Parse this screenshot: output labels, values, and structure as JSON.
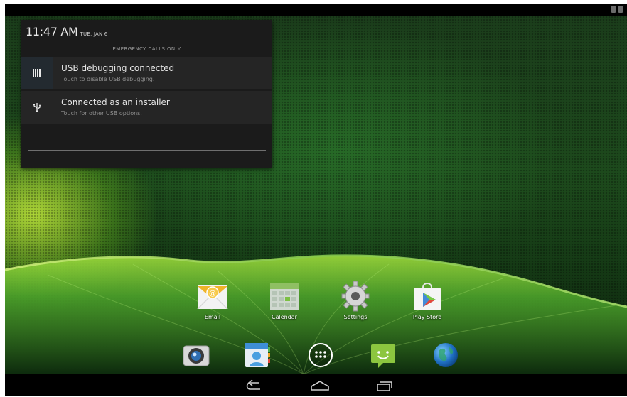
{
  "notification_panel": {
    "time": "11:47 AM",
    "date": "TUE, JAN 6",
    "carrier_status": "EMERGENCY CALLS ONLY",
    "notifications": [
      {
        "icon": "usb-debug-icon",
        "title": "USB debugging connected",
        "subtitle": "Touch to disable USB debugging."
      },
      {
        "icon": "usb-icon",
        "title": "Connected as an installer",
        "subtitle": "Touch for other USB options."
      }
    ]
  },
  "home_apps": [
    {
      "label": "Email",
      "icon": "email-icon"
    },
    {
      "label": "Calendar",
      "icon": "calendar-icon"
    },
    {
      "label": "Settings",
      "icon": "settings-gear-icon"
    },
    {
      "label": "Play Store",
      "icon": "play-store-icon"
    }
  ],
  "dock": [
    {
      "icon": "camera-icon"
    },
    {
      "icon": "people-icon"
    },
    {
      "icon": "all-apps-icon"
    },
    {
      "icon": "messaging-icon"
    },
    {
      "icon": "browser-globe-icon"
    }
  ],
  "navigation": [
    "back",
    "home",
    "recent-apps"
  ],
  "colors": {
    "status_bar": "#000000",
    "panel_background": "#1b1b1b",
    "notification_row": "#252525",
    "wallpaper_green": "#2a6a22"
  }
}
